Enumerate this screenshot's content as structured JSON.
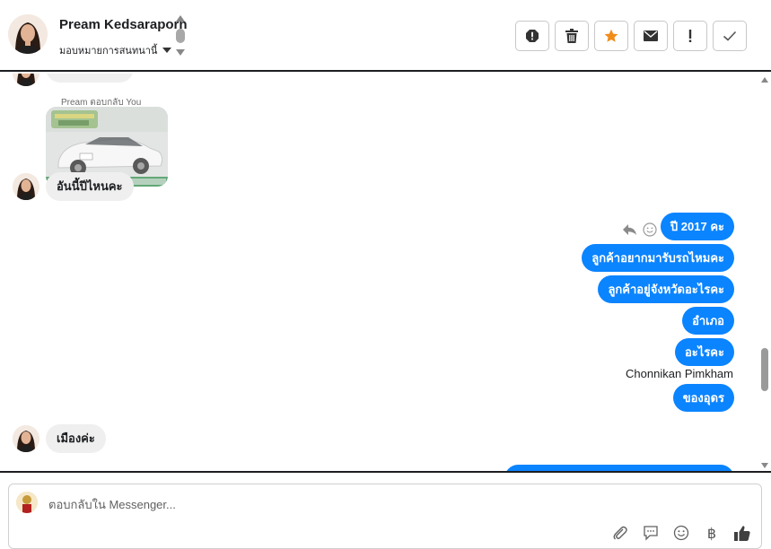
{
  "header": {
    "contact_name": "Pream Kedsaraporn",
    "assign_label": "มอบหมายการสนทนานี้",
    "toolbar": [
      {
        "icon": "spam-octagon-icon",
        "color": "#333333"
      },
      {
        "icon": "trash-icon",
        "color": "#333333"
      },
      {
        "icon": "star-icon",
        "color": "#f08c1a"
      },
      {
        "icon": "envelope-icon",
        "color": "#333333"
      },
      {
        "icon": "exclamation-icon",
        "color": "#333333"
      },
      {
        "icon": "check-icon",
        "color": "#555555"
      }
    ]
  },
  "chat": {
    "reply_label": "Pream ตอบกลับ You",
    "incoming": [
      {
        "text": "อันนี้ปีไหนคะ"
      },
      {
        "text": "เมืองค่ะ"
      }
    ],
    "outgoing": [
      {
        "text": "ปี 2017 คะ"
      },
      {
        "text": "ลูกค้าอยากมารับรถไหมคะ"
      },
      {
        "text": "ลูกค้าอยู่จังหวัดอะไรคะ"
      },
      {
        "text": "อำเภอ"
      },
      {
        "text": "อะไรคะ"
      },
      {
        "text": "ของอุดร"
      }
    ],
    "sender_name": "Chonnikan Pimkham",
    "accent_color": "#0b84ff"
  },
  "composer": {
    "placeholder": "ตอบกลับใน Messenger...",
    "tools": [
      "paperclip-icon",
      "quick-reply-icon",
      "emoji-icon",
      "baht-icon",
      "thumbs-up-icon"
    ],
    "baht_symbol": "฿"
  }
}
